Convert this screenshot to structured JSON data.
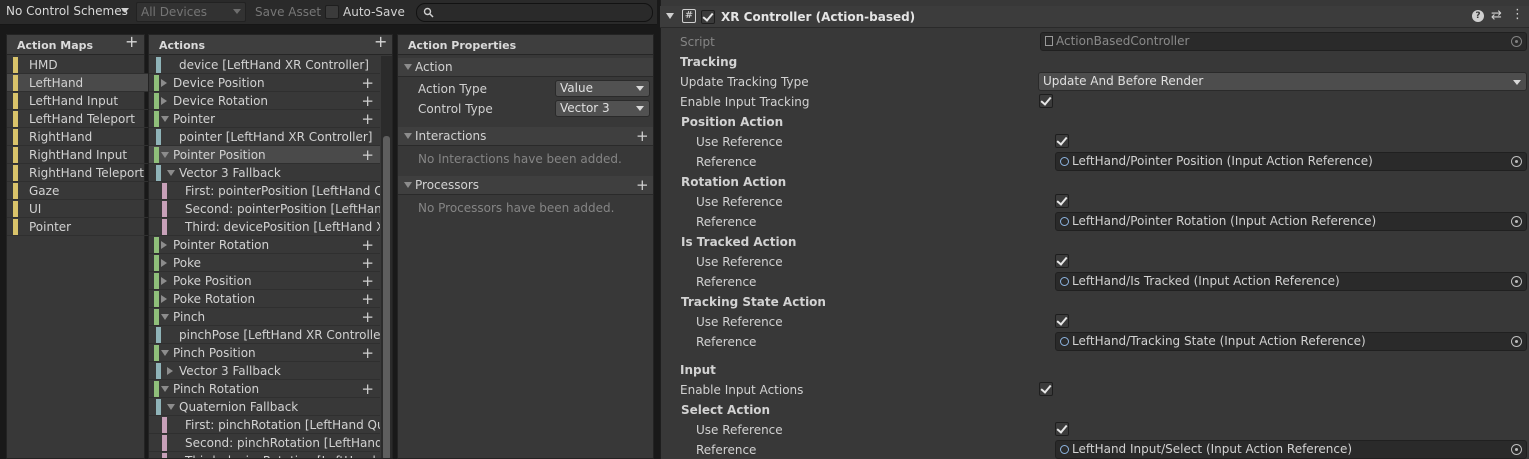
{
  "toolbar": {
    "control_schemes": "No Control Schemes",
    "devices": "All Devices",
    "save_asset": "Save Asset",
    "auto_save": "Auto-Save",
    "search_placeholder": ""
  },
  "action_maps": {
    "title": "Action Maps",
    "items": [
      "HMD",
      "LeftHand",
      "LeftHand Input",
      "LeftHand Teleport",
      "RightHand",
      "RightHand Input",
      "RightHand Teleport",
      "Gaze",
      "UI",
      "Pointer"
    ],
    "selected": "LeftHand"
  },
  "actions": {
    "title": "Actions",
    "rows": [
      {
        "label": "device [LeftHand XR Controller]",
        "kind": "binding",
        "indent": 1,
        "color": "#8fb3b8"
      },
      {
        "label": "Device Position",
        "kind": "action",
        "expanded": false
      },
      {
        "label": "Device Rotation",
        "kind": "action",
        "expanded": false
      },
      {
        "label": "Pointer",
        "kind": "action",
        "expanded": true
      },
      {
        "label": "pointer [LeftHand XR Controller]",
        "kind": "binding",
        "indent": 1,
        "color": "#8fb3b8"
      },
      {
        "label": "Pointer Position",
        "kind": "action",
        "expanded": true,
        "selected": true
      },
      {
        "label": "Vector 3 Fallback",
        "kind": "composite",
        "expanded": true
      },
      {
        "label": "First: pointerPosition [LeftHand Qua",
        "kind": "part",
        "color": "#c7a0b8"
      },
      {
        "label": "Second: pointerPosition [LeftHand",
        "kind": "part",
        "color": "#c7a0b8"
      },
      {
        "label": "Third: devicePosition [LeftHand XR",
        "kind": "part",
        "color": "#c7a0b8"
      },
      {
        "label": "Pointer Rotation",
        "kind": "action",
        "expanded": false
      },
      {
        "label": "Poke",
        "kind": "action",
        "expanded": false
      },
      {
        "label": "Poke Position",
        "kind": "action",
        "expanded": false
      },
      {
        "label": "Poke Rotation",
        "kind": "action",
        "expanded": false
      },
      {
        "label": "Pinch",
        "kind": "action",
        "expanded": true
      },
      {
        "label": "pinchPose [LeftHand XR Controller]",
        "kind": "binding",
        "indent": 1,
        "color": "#8fb3b8"
      },
      {
        "label": "Pinch Position",
        "kind": "action",
        "expanded": true
      },
      {
        "label": "Vector 3 Fallback",
        "kind": "composite",
        "expanded": false
      },
      {
        "label": "Pinch Rotation",
        "kind": "action",
        "expanded": true
      },
      {
        "label": "Quaternion Fallback",
        "kind": "composite",
        "expanded": true
      },
      {
        "label": "First: pinchRotation [LeftHand Qual",
        "kind": "part",
        "color": "#c7a0b8"
      },
      {
        "label": "Second: pinchRotation [LeftHand X",
        "kind": "part",
        "color": "#c7a0b8"
      },
      {
        "label": "Third: deviceRotation [LeftHand XR",
        "kind": "part",
        "color": "#c7a0b8"
      }
    ]
  },
  "properties": {
    "title": "Action Properties",
    "action_section": "Action",
    "action_type_label": "Action Type",
    "action_type_value": "Value",
    "control_type_label": "Control Type",
    "control_type_value": "Vector 3",
    "interactions_section": "Interactions",
    "interactions_empty": "No Interactions have been added.",
    "processors_section": "Processors",
    "processors_empty": "No Processors have been added."
  },
  "inspector": {
    "component_title": "XR Controller (Action-based)",
    "script_label": "Script",
    "script_value": "ActionBasedController",
    "tracking_header": "Tracking",
    "update_tracking_label": "Update Tracking Type",
    "update_tracking_value": "Update And Before Render",
    "enable_input_tracking_label": "Enable Input Tracking",
    "position_action": "Position Action",
    "rotation_action": "Rotation Action",
    "is_tracked_action": "Is Tracked Action",
    "tracking_state_action": "Tracking State Action",
    "use_reference_label": "Use Reference",
    "reference_label": "Reference",
    "position_ref": "LeftHand/Pointer Position (Input Action Reference)",
    "rotation_ref": "LeftHand/Pointer Rotation (Input Action Reference)",
    "is_tracked_ref": "LeftHand/Is Tracked (Input Action Reference)",
    "tracking_state_ref": "LeftHand/Tracking State (Input Action Reference)",
    "input_header": "Input",
    "enable_input_actions_label": "Enable Input Actions",
    "select_action": "Select Action",
    "select_ref": "LeftHand Input/Select (Input Action Reference)"
  },
  "colors": {
    "map_marker": "#d9c36a",
    "action_marker": "#8fbf7a",
    "binding_marker": "#8fb3b8",
    "part_marker": "#c7a0b8"
  }
}
